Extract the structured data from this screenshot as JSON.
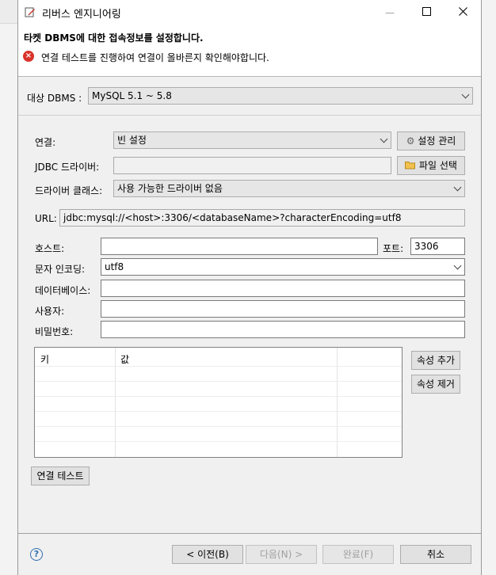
{
  "window": {
    "title": "리버스 엔지니어링",
    "minimize": "—",
    "maximize": "☐",
    "close": "✕"
  },
  "header": {
    "title": "타켓 DBMS에 대한 접속정보를 설정합니다.",
    "error_icon": "x-circle-icon",
    "error_glyph": "×",
    "error_message": "연결 테스트를 진행하여 연결이 올바른지 확인해야합니다."
  },
  "dbms": {
    "label": "대상 DBMS :",
    "value": "MySQL 5.1 ~ 5.8"
  },
  "connection": {
    "label": "연결:",
    "value": "빈 설정",
    "manage_button": "설정 관리",
    "manage_icon": "gear-icon",
    "manage_glyph": "⚙"
  },
  "jdbc": {
    "label": "JDBC 드라이버:",
    "value": "",
    "file_button": "파일 선택",
    "file_icon": "folder-icon",
    "file_glyph": "📂"
  },
  "driver_class": {
    "label": "드라이버 클래스:",
    "value": "사용 가능한 드라이버 없음"
  },
  "url": {
    "label": "URL:",
    "value": "jdbc:mysql://<host>:3306/<databaseName>?characterEncoding=utf8"
  },
  "host": {
    "label": "호스트:",
    "value": ""
  },
  "port": {
    "label": "포트:",
    "value": "3306"
  },
  "encoding": {
    "label": "문자 인코딩:",
    "value": "utf8"
  },
  "database": {
    "label": "데이터베이스:",
    "value": ""
  },
  "user": {
    "label": "사용자:",
    "value": ""
  },
  "password": {
    "label": "비밀번호:",
    "value": ""
  },
  "properties": {
    "columns": [
      "키",
      "값",
      ""
    ],
    "add_button": "속성 추가",
    "remove_button": "속성 제거"
  },
  "test_button": "연결 테스트",
  "footer": {
    "help_glyph": "?",
    "prev": "< 이전(B)",
    "next": "다음(N) >",
    "finish": "완료(F)",
    "cancel": "취소"
  }
}
